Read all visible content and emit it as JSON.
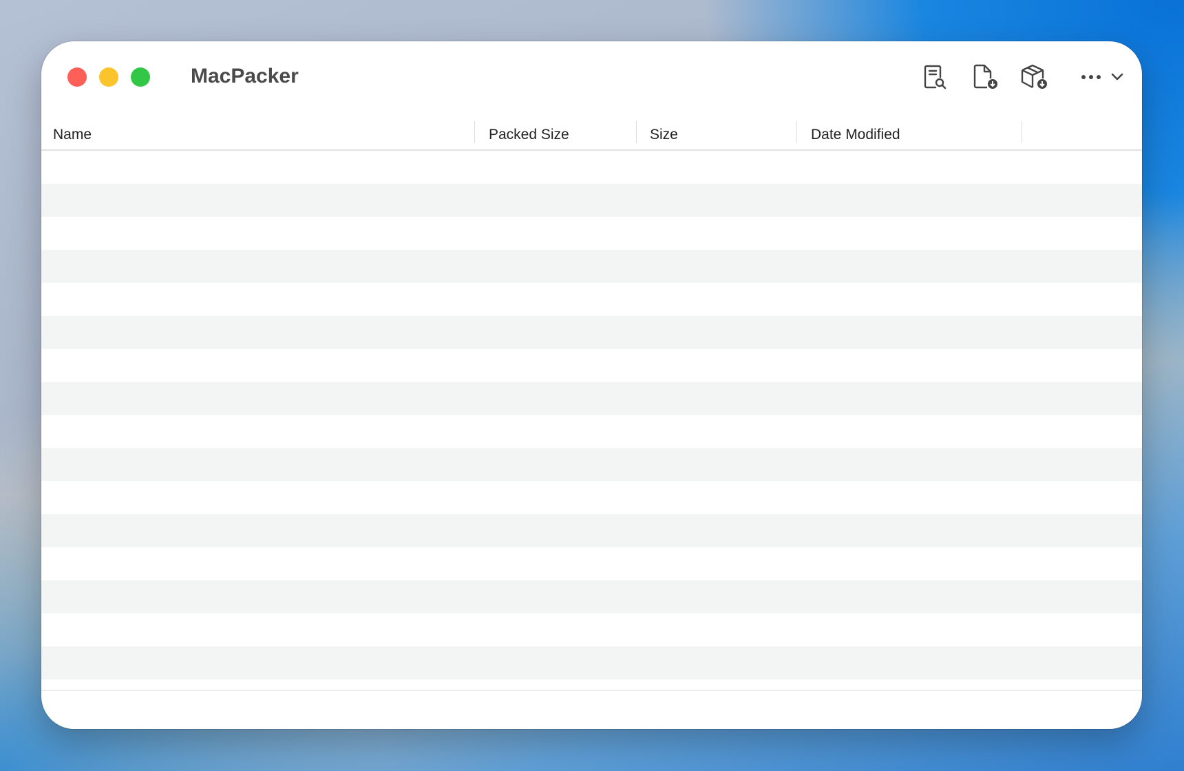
{
  "window": {
    "title": "MacPacker"
  },
  "toolbar": {
    "icons": [
      "preview-icon",
      "extract-file-icon",
      "extract-archive-icon",
      "more-icon"
    ]
  },
  "table": {
    "columns": [
      "Name",
      "Packed Size",
      "Size",
      "Date Modified"
    ],
    "rows": []
  },
  "colors": {
    "close": "#fe5f57",
    "minimize": "#fbc32c",
    "zoom": "#33c748"
  }
}
